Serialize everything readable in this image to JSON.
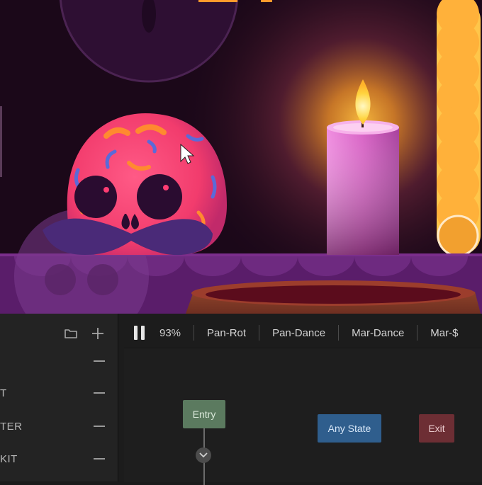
{
  "left_panel": {
    "toolbar": {
      "folder_icon": "folder-icon",
      "add_icon": "plus-icon"
    },
    "params": [
      {
        "label": ""
      },
      {
        "label": "T"
      },
      {
        "label": "TER"
      },
      {
        "label": "KIT"
      }
    ]
  },
  "state_machine": {
    "zoom": "93%",
    "tabs": [
      "Pan-Rot",
      "Pan-Dance",
      "Mar-Dance",
      "Mar-$"
    ],
    "nodes": {
      "entry": "Entry",
      "any_state": "Any State",
      "exit": "Exit"
    }
  },
  "colors": {
    "entry_node": "#5b7a5f",
    "any_state_node": "#2f5e8d",
    "exit_node": "#6d2e34",
    "skull": "#f2426f",
    "candle": "#e05fc0",
    "flame": "#ffd34a"
  }
}
